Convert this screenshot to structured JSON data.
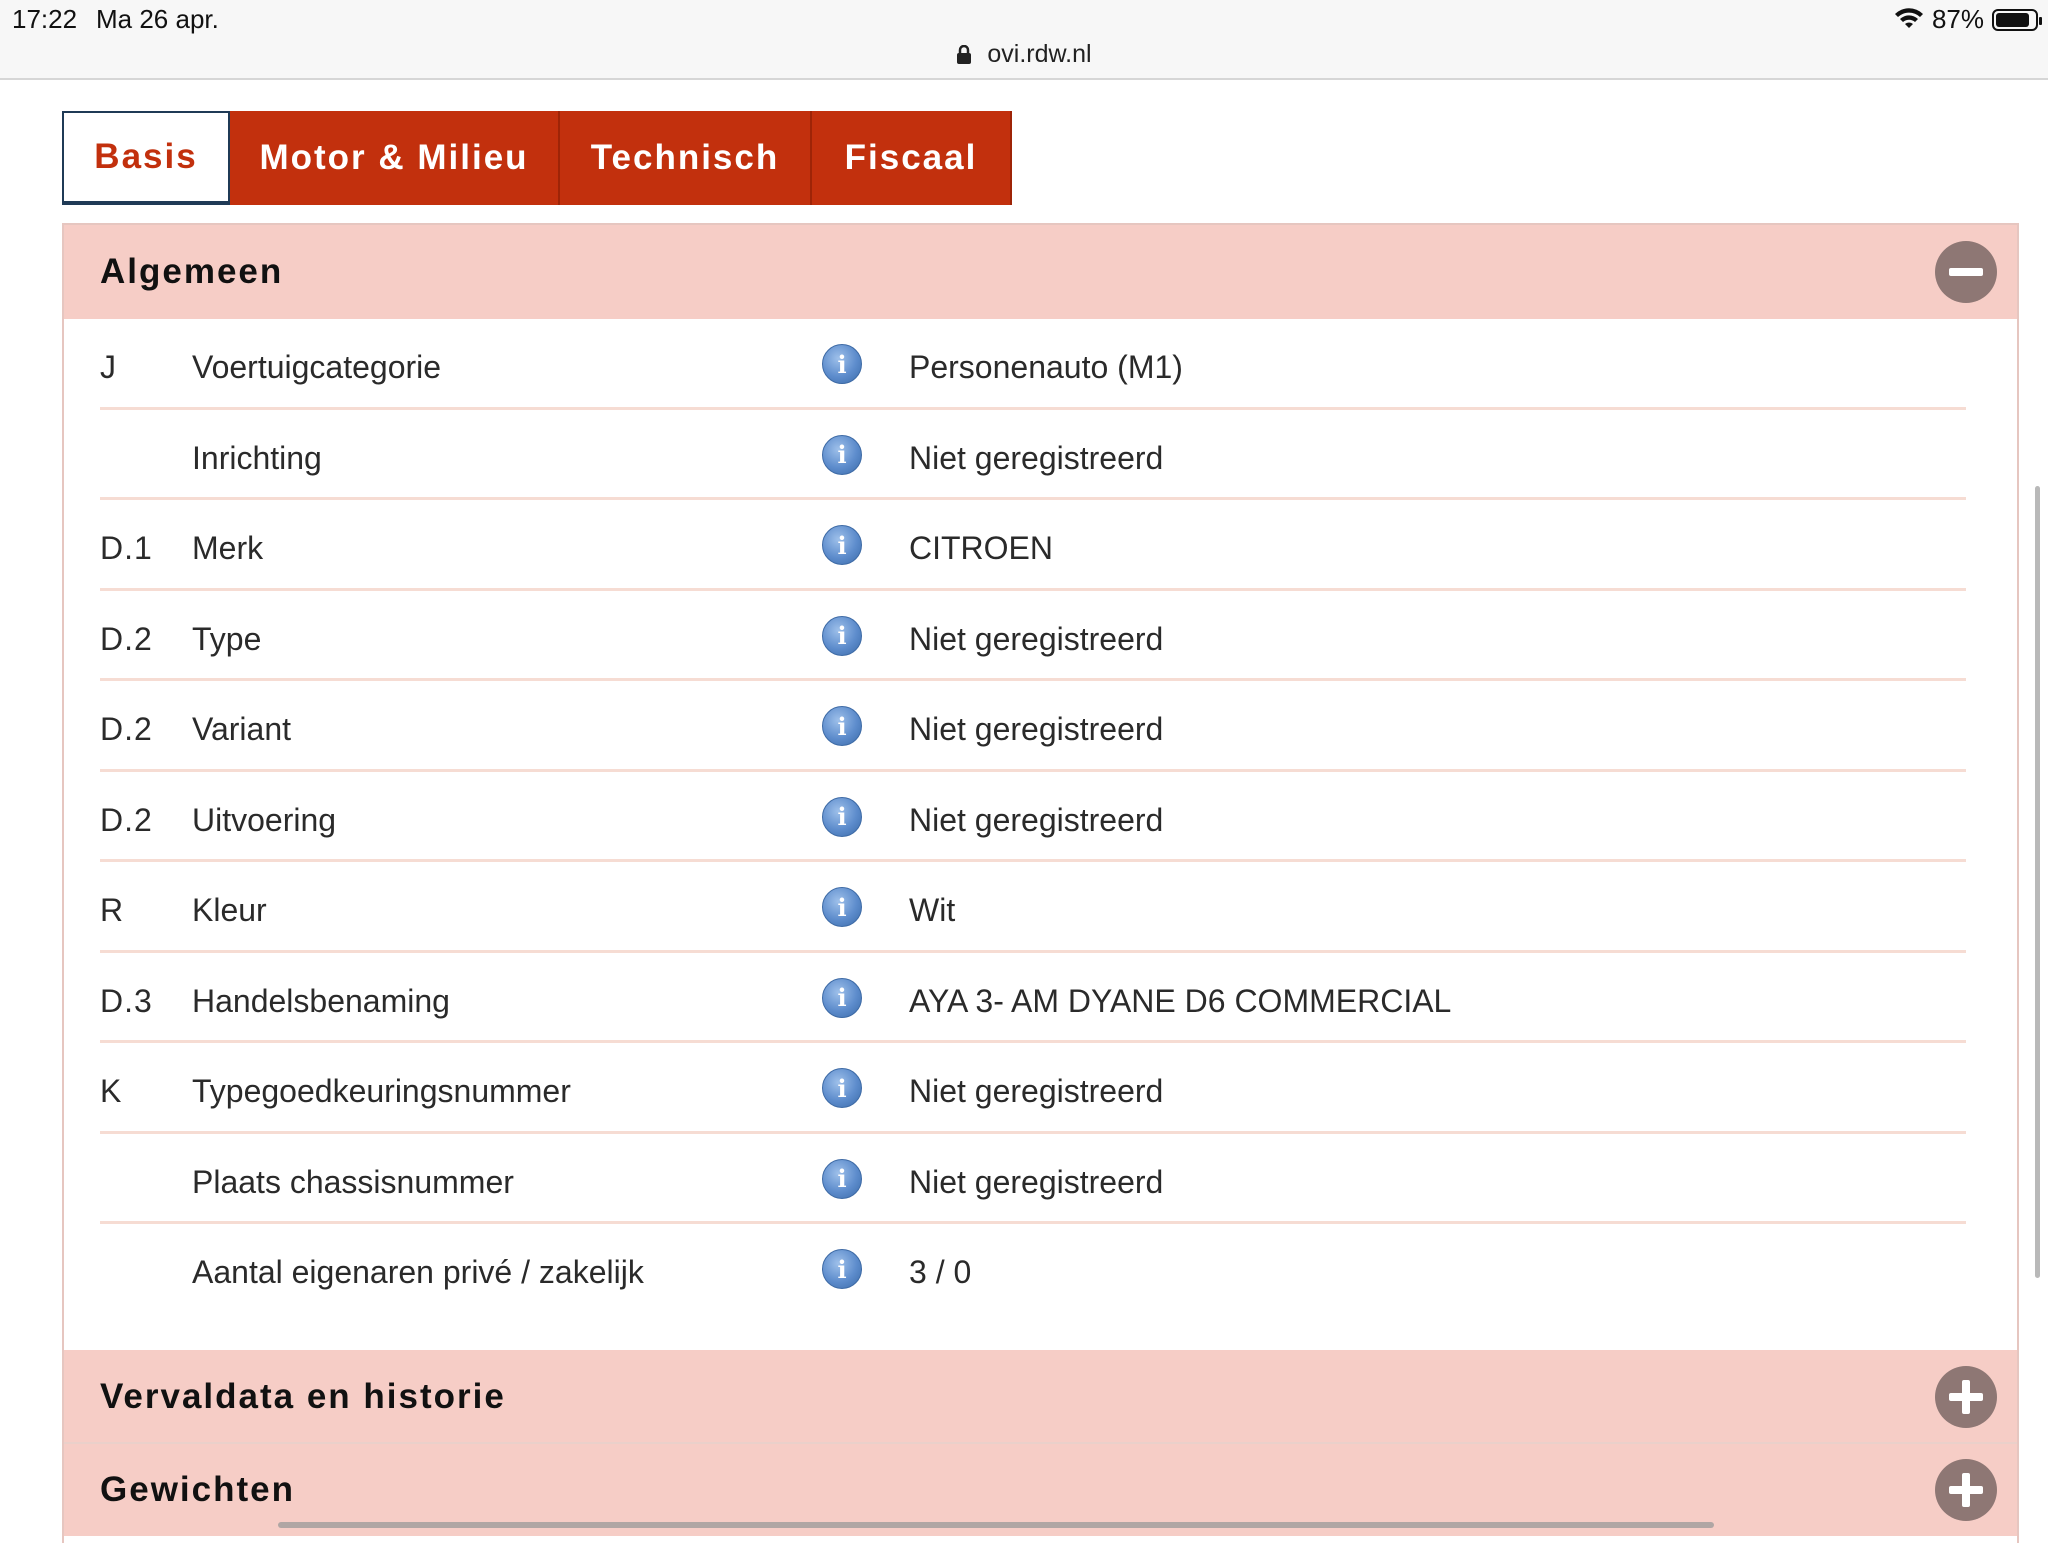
{
  "status_bar": {
    "time": "17:22",
    "date": "Ma 26 apr.",
    "battery": "87%",
    "battery_level": 0.87,
    "url": "ovi.rdw.nl"
  },
  "tabs": [
    {
      "label": "Basis",
      "active": true
    },
    {
      "label": "Motor & Milieu",
      "active": false
    },
    {
      "label": "Technisch",
      "active": false
    },
    {
      "label": "Fiscaal",
      "active": false
    }
  ],
  "sections": {
    "algemeen": {
      "title": "Algemeen",
      "expanded": true,
      "rows": [
        {
          "code": "J",
          "label": "Voertuigcategorie",
          "value": "Personenauto (M1)"
        },
        {
          "code": "",
          "label": "Inrichting",
          "value": "Niet geregistreerd"
        },
        {
          "code": "D.1",
          "label": "Merk",
          "value": "CITROEN"
        },
        {
          "code": "D.2",
          "label": "Type",
          "value": "Niet geregistreerd"
        },
        {
          "code": "D.2",
          "label": "Variant",
          "value": "Niet geregistreerd"
        },
        {
          "code": "D.2",
          "label": "Uitvoering",
          "value": "Niet geregistreerd"
        },
        {
          "code": "R",
          "label": "Kleur",
          "value": "Wit"
        },
        {
          "code": "D.3",
          "label": "Handelsbenaming",
          "value": "AYA 3- AM DYANE D6 COMMERCIAL"
        },
        {
          "code": "K",
          "label": "Typegoedkeuringsnummer",
          "value": "Niet geregistreerd"
        },
        {
          "code": "",
          "label": "Plaats chassisnummer",
          "value": "Niet geregistreerd"
        },
        {
          "code": "",
          "label": "Aantal eigenaren privé / zakelijk",
          "value": "3 / 0"
        }
      ]
    },
    "vervaldata": {
      "title": "Vervaldata en historie",
      "expanded": false
    },
    "gewichten": {
      "title": "Gewichten",
      "expanded": false
    }
  },
  "colors": {
    "tab_red": "#c2300d",
    "section_header": "#f6cdc6",
    "toggle": "#8e7774",
    "info_blue": "#5d8ccc"
  },
  "icons": {
    "info": "info-icon",
    "collapse": "minus-circle-icon",
    "expand": "plus-circle-icon",
    "lock": "lock-icon",
    "wifi": "wifi-icon",
    "battery": "battery-icon"
  }
}
